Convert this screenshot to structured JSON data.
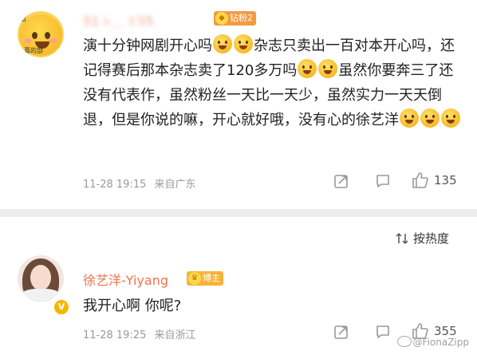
{
  "comment1": {
    "username": "51ゝ＿ゞ55",
    "badge": "钻粉2",
    "avatar_text": "哈",
    "avatar_text2": "喜的部",
    "text_parts": [
      "演十分钟网剧开心吗",
      "杂志只卖出一百对本开心吗，还记得赛后那本杂志卖了120多万吗",
      "虽然你要奔三了还没有代表作，虽然粉丝一天比一天少，虽然实力一天天倒退，但是你说的嘛，开心就好哦，没有心的徐艺洋"
    ],
    "time": "11-28 19:15",
    "source": "来自广东",
    "likes": "135"
  },
  "sort": {
    "label": "按热度"
  },
  "comment2": {
    "username": "徐艺洋-Yiyang",
    "badge": "博主",
    "verified": "V",
    "text": "我开心啊 你呢?",
    "time": "11-28 19:25",
    "source": "来自浙江",
    "likes": "355"
  },
  "watermark": "@FionaZipp",
  "colors": {
    "username": "#eb7350",
    "divider": "#ededed",
    "meta": "#999999"
  }
}
